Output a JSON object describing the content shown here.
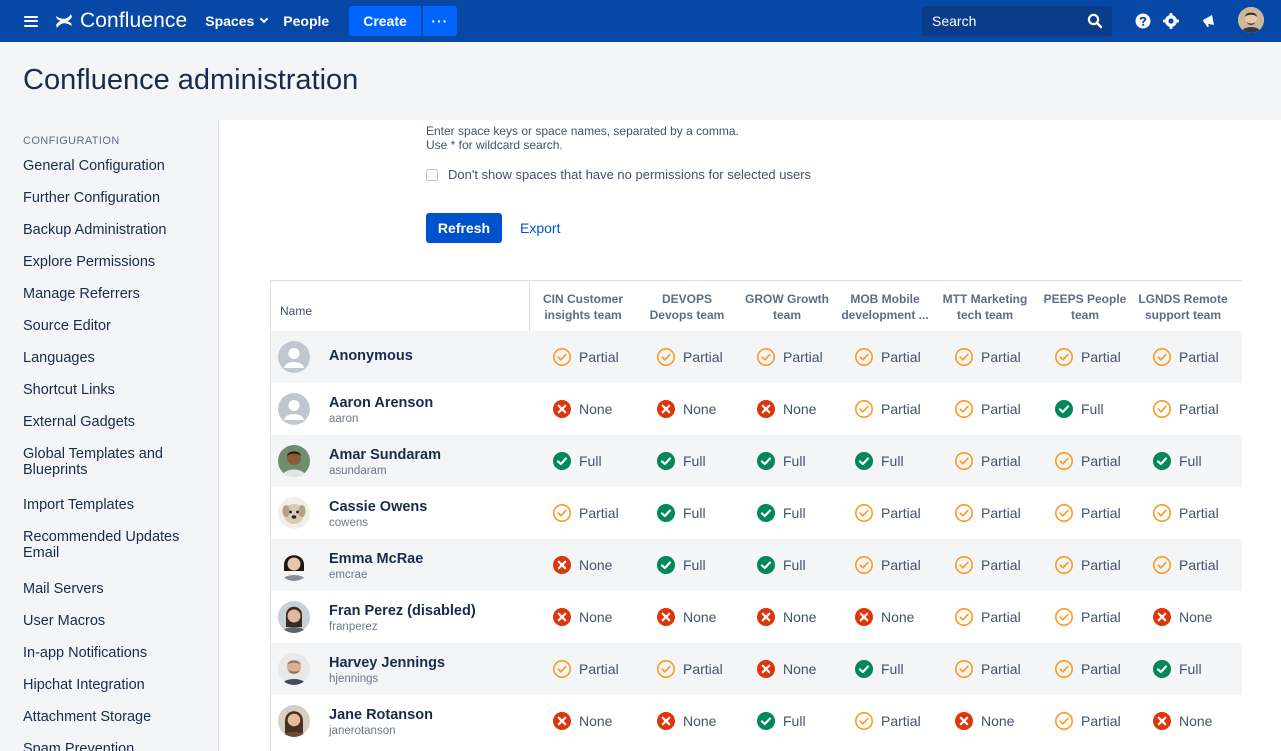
{
  "nav": {
    "logo_text": "Confluence",
    "spaces_label": "Spaces",
    "people_label": "People",
    "create_label": "Create",
    "more_label": "···",
    "search_placeholder": "Search"
  },
  "header": {
    "title": "Confluence administration"
  },
  "sidebar": {
    "heading": "CONFIGURATION",
    "items": [
      "General Configuration",
      "Further Configuration",
      "Backup Administration",
      "Explore Permissions",
      "Manage Referrers",
      "Source Editor",
      "Languages",
      "Shortcut Links",
      "External Gadgets",
      "Global Templates and Blueprints",
      "Import Templates",
      "Recommended Updates Email",
      "Mail Servers",
      "User Macros",
      "In-app Notifications",
      "Hipchat Integration",
      "Attachment Storage",
      "Spam Prevention"
    ]
  },
  "filters": {
    "hint_line1": "Enter space keys or space names, separated by a comma.",
    "hint_line2": "Use * for wildcard search.",
    "checkbox_label": "Don't show spaces that have no permissions for selected users",
    "refresh_label": "Refresh",
    "export_label": "Export"
  },
  "table": {
    "name_header": "Name",
    "columns": [
      [
        "CIN Customer",
        "insights team"
      ],
      [
        "DEVOPS",
        "Devops team"
      ],
      [
        "GROW Growth",
        "team"
      ],
      [
        "MOB Mobile",
        "development ..."
      ],
      [
        "MTT Marketing",
        "tech team"
      ],
      [
        "PEEPS People",
        "team"
      ],
      [
        "LGNDS Remote",
        "support team"
      ]
    ],
    "status_labels": {
      "partial": "Partial",
      "none": "None",
      "full": "Full"
    },
    "rows": [
      {
        "name": "Anonymous",
        "id": "",
        "avatar": "default",
        "perms": [
          "partial",
          "partial",
          "partial",
          "partial",
          "partial",
          "partial",
          "partial"
        ]
      },
      {
        "name": "Aaron Arenson",
        "id": "aaron",
        "avatar": "default",
        "perms": [
          "none",
          "none",
          "none",
          "partial",
          "partial",
          "full",
          "partial"
        ]
      },
      {
        "name": "Amar Sundaram",
        "id": "asundaram",
        "avatar": "photo",
        "perms": [
          "full",
          "full",
          "full",
          "full",
          "partial",
          "partial",
          "full"
        ]
      },
      {
        "name": "Cassie Owens",
        "id": "cowens",
        "avatar": "photo",
        "perms": [
          "partial",
          "full",
          "full",
          "partial",
          "partial",
          "partial",
          "partial"
        ]
      },
      {
        "name": "Emma McRae",
        "id": "emcrae",
        "avatar": "photo",
        "perms": [
          "none",
          "full",
          "full",
          "partial",
          "partial",
          "partial",
          "partial"
        ]
      },
      {
        "name": "Fran Perez (disabled)",
        "id": "franperez",
        "avatar": "photo",
        "perms": [
          "none",
          "none",
          "none",
          "none",
          "partial",
          "partial",
          "none"
        ]
      },
      {
        "name": "Harvey Jennings",
        "id": "hjennings",
        "avatar": "photo",
        "perms": [
          "partial",
          "partial",
          "none",
          "full",
          "partial",
          "partial",
          "full"
        ]
      },
      {
        "name": "Jane Rotanson",
        "id": "janerotanson",
        "avatar": "photo",
        "perms": [
          "none",
          "none",
          "full",
          "partial",
          "none",
          "partial",
          "none"
        ]
      }
    ]
  },
  "colors": {
    "nav_bg": "#0747a6",
    "primary": "#0052cc",
    "partial": "#ff991f",
    "none": "#de350b",
    "full": "#00875a"
  }
}
